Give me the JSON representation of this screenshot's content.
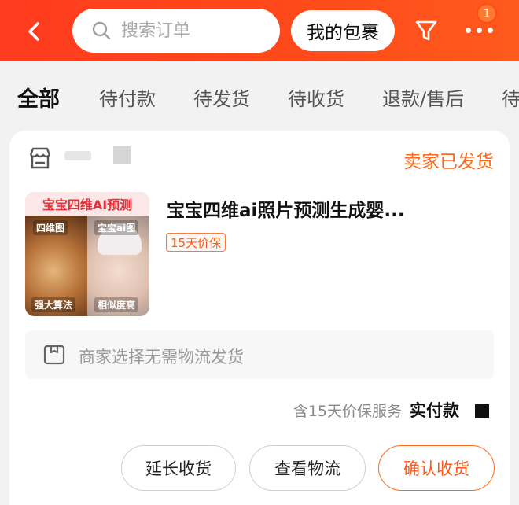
{
  "header": {
    "search_placeholder": "搜索订单",
    "package_label": "我的包裹",
    "badge_count": "1"
  },
  "tabs": [
    {
      "label": "全部",
      "active": true
    },
    {
      "label": "待付款"
    },
    {
      "label": "待发货"
    },
    {
      "label": "待收货"
    },
    {
      "label": "退款/售后"
    },
    {
      "label": "待"
    }
  ],
  "order": {
    "status": "卖家已发货",
    "product": {
      "image_banner": "宝宝四维AI预测",
      "image_left_label": "四维图",
      "image_right_label": "宝宝ai图",
      "image_bottom_left": "强大算法",
      "image_bottom_right": "相似度高",
      "title": "宝宝四维ai照片预测生成婴...",
      "tag": "15天价保"
    },
    "logistics_text": "商家选择无需物流发货",
    "price_note": "含15天价保服务",
    "paid_label": "实付款"
  },
  "actions": {
    "extend": "延长收货",
    "track": "查看物流",
    "confirm": "确认收货"
  },
  "colors": {
    "header": "#ff4a1a",
    "accent": "#ff6a1a"
  }
}
